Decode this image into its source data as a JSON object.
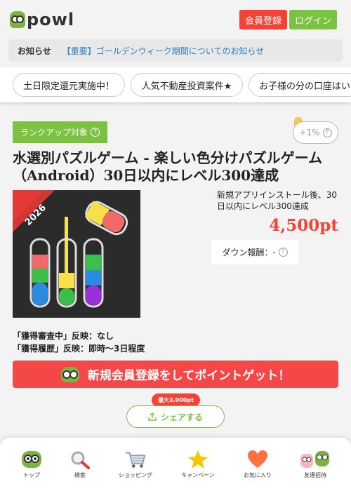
{
  "header": {
    "logo_text": "powl",
    "register_label": "会員登録",
    "login_label": "ログイン"
  },
  "notice": {
    "label": "お知らせ",
    "link": "【重要】ゴールデンウィーク期間についてのお知らせ"
  },
  "tags": [
    "土日限定還元実施中！",
    "人気不動産投資案件★",
    "お子様の分の口座はい"
  ],
  "offer": {
    "rank_badge": "ランクアップ対象",
    "boost": "+1%",
    "title": "水選別パズルゲーム - 楽しい色分けパズルゲーム（Android）30日以内にレベル300達成",
    "image_banner": "2026",
    "description": "新規アプリインストール後、30日以内にレベル300達成",
    "points": "4,500pt",
    "down_reward": "ダウン報酬：-",
    "status_line1": "「獲得審査中」反映：なし",
    "status_line2": "「獲得履歴」反映：即時～3日程度",
    "cta_label": "新規会員登録をしてポイントゲット！",
    "max_badge": "最大3,000pt",
    "share_label": "シェアする"
  },
  "bottom_nav": [
    {
      "label": "トップ",
      "icon": "owl-icon"
    },
    {
      "label": "検索",
      "icon": "search-icon"
    },
    {
      "label": "ショッピング",
      "icon": "cart-icon"
    },
    {
      "label": "キャンペーン",
      "icon": "star-icon"
    },
    {
      "label": "お気に入り",
      "icon": "heart-icon"
    },
    {
      "label": "友達招待",
      "icon": "friends-icon"
    }
  ],
  "colors": {
    "red": "#f44336",
    "green": "#7cc242",
    "link_blue": "#2c7fc9"
  }
}
